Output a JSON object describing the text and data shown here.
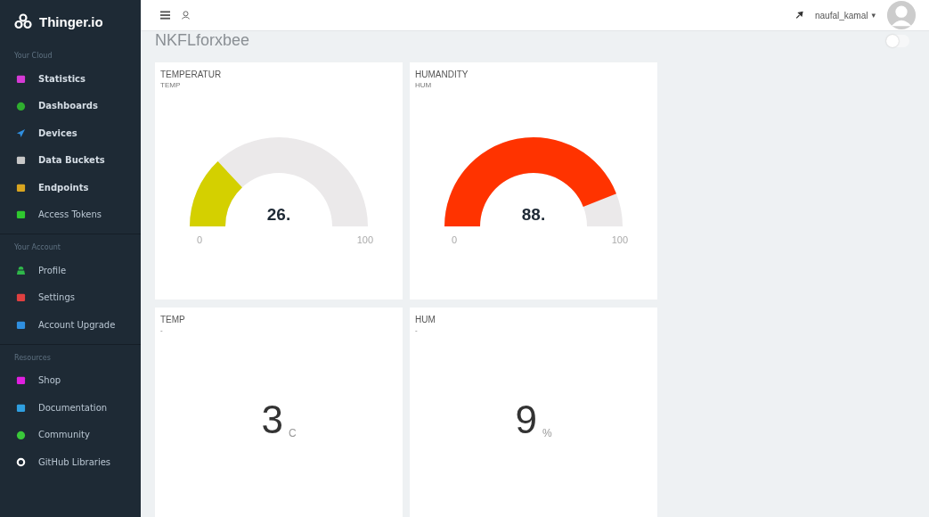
{
  "brand": {
    "name": "Thinger.io"
  },
  "sidebar": {
    "sections": [
      {
        "title": "Your Cloud",
        "items": [
          {
            "label": "Statistics",
            "color": "#d63ad6",
            "bold": true
          },
          {
            "label": "Dashboards",
            "color": "#2fae2f",
            "bold": true
          },
          {
            "label": "Devices",
            "color": "#2f8fe0",
            "bold": true
          },
          {
            "label": "Data Buckets",
            "color": "#c8c8c8",
            "bold": true
          },
          {
            "label": "Endpoints",
            "color": "#d9a520",
            "bold": true
          },
          {
            "label": "Access Tokens",
            "color": "#2fc82f",
            "bold": false
          }
        ]
      },
      {
        "title": "Your Account",
        "items": [
          {
            "label": "Profile",
            "color": "#2fb84a",
            "bold": false
          },
          {
            "label": "Settings",
            "color": "#e04040",
            "bold": false
          },
          {
            "label": "Account Upgrade",
            "color": "#2f8fe0",
            "bold": false
          }
        ]
      },
      {
        "title": "Resources",
        "items": [
          {
            "label": "Shop",
            "color": "#e020e0",
            "bold": false
          },
          {
            "label": "Documentation",
            "color": "#2f9fe0",
            "bold": false
          },
          {
            "label": "Community",
            "color": "#3ac83a",
            "bold": false
          },
          {
            "label": "GitHub Libraries",
            "color": "#ffffff",
            "bold": false
          }
        ]
      }
    ]
  },
  "topbar": {
    "user": "naufal_kamal",
    "caret": "▾"
  },
  "dashboard": {
    "title": "NKFLforxbee",
    "toggle_on": false
  },
  "widgets": [
    {
      "kind": "gauge",
      "title": "TEMPERATUR",
      "subtitle": "TEMP",
      "color": "#d4d000",
      "value": "26.",
      "min": "0",
      "max": "100"
    },
    {
      "kind": "gauge",
      "title": "HUMANDITY",
      "subtitle": "HUM",
      "color": "#ff3300",
      "value": "88.",
      "min": "0",
      "max": "100"
    },
    {
      "kind": "text",
      "title": "TEMP",
      "subtitle": "-",
      "value": "3",
      "unit": "C"
    },
    {
      "kind": "text",
      "title": "HUM",
      "subtitle": "-",
      "value": "9",
      "unit": "%"
    }
  ]
}
